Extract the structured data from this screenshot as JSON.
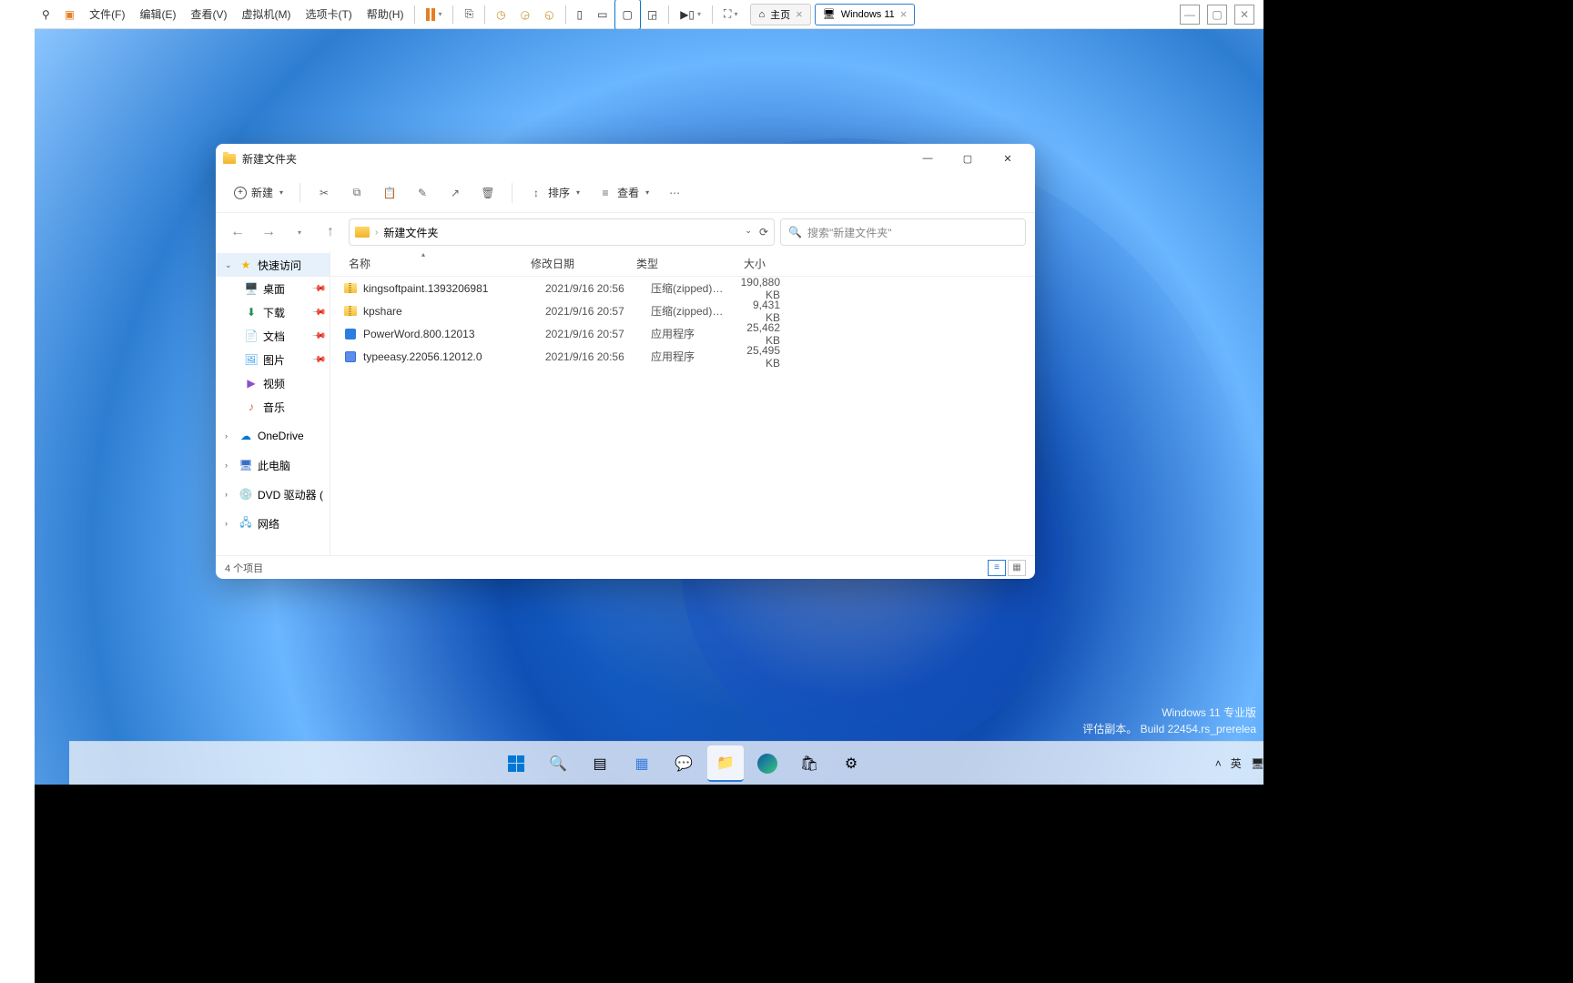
{
  "vmware": {
    "menus": [
      "文件(F)",
      "编辑(E)",
      "查看(V)",
      "虚拟机(M)",
      "选项卡(T)",
      "帮助(H)"
    ],
    "tabs": [
      {
        "label": "主页",
        "icon": "home",
        "closeable": true
      },
      {
        "label": "Windows 11",
        "icon": "monitor",
        "closeable": true,
        "active": true
      }
    ]
  },
  "explorer": {
    "title": "新建文件夹",
    "cmdbar": {
      "new": "新建",
      "sort": "排序",
      "view": "查看"
    },
    "breadcrumb": [
      "新建文件夹"
    ],
    "search_placeholder": "搜索\"新建文件夹\"",
    "sidebar": {
      "quick_access": "快速访问",
      "items": [
        {
          "label": "桌面",
          "icon": "🖥️",
          "color": "#3aa0e8"
        },
        {
          "label": "下载",
          "icon": "⬇",
          "color": "#2e8b57"
        },
        {
          "label": "文档",
          "icon": "📄",
          "color": "#5b8def"
        },
        {
          "label": "图片",
          "icon": "🖼",
          "color": "#3aa0e8"
        },
        {
          "label": "视频",
          "icon": "▶",
          "color": "#8a4fc9"
        },
        {
          "label": "音乐",
          "icon": "♪",
          "color": "#e05757"
        }
      ],
      "onedrive": "OneDrive",
      "this_pc": "此电脑",
      "dvd": "DVD 驱动器 (D:) C(",
      "network": "网络"
    },
    "columns": {
      "name": "名称",
      "date": "修改日期",
      "type": "类型",
      "size": "大小"
    },
    "files": [
      {
        "name": "kingsoftpaint.1393206981",
        "date": "2021/9/16 20:56",
        "type": "压缩(zipped)文件...",
        "size": "190,880 KB",
        "kind": "zip"
      },
      {
        "name": "kpshare",
        "date": "2021/9/16 20:57",
        "type": "压缩(zipped)文件...",
        "size": "9,431 KB",
        "kind": "zip"
      },
      {
        "name": "PowerWord.800.12013",
        "date": "2021/9/16 20:57",
        "type": "应用程序",
        "size": "25,462 KB",
        "kind": "exe"
      },
      {
        "name": "typeeasy.22056.12012.0",
        "date": "2021/9/16 20:56",
        "type": "应用程序",
        "size": "25,495 KB",
        "kind": "exe2"
      }
    ],
    "status": "4 个项目"
  },
  "watermark": {
    "line1": "Windows 11 专业版",
    "line2": "评估副本。 Build 22454.rs_prerelea"
  },
  "taskbar": {
    "items": [
      "start",
      "search",
      "taskview",
      "widgets",
      "chat",
      "explorer",
      "edge",
      "store",
      "settings"
    ]
  },
  "tray": {
    "ime": "英"
  }
}
